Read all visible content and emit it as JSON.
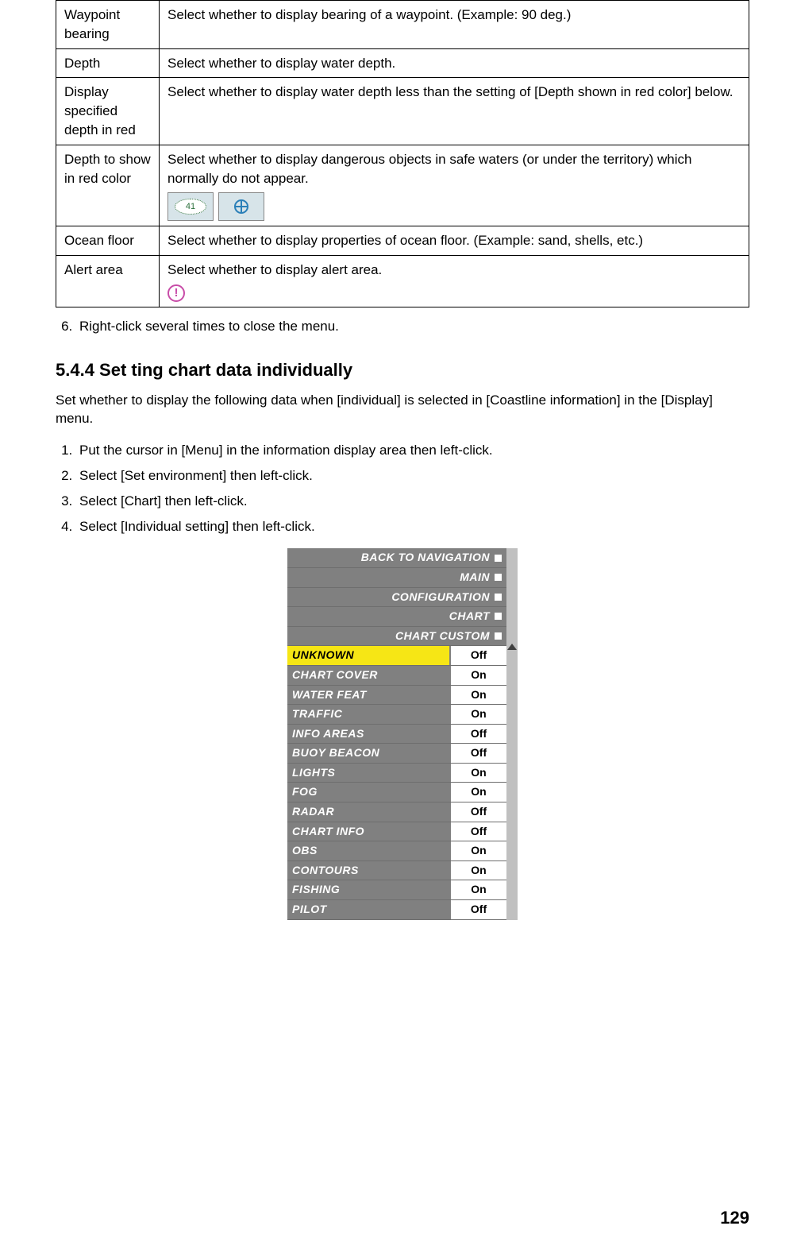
{
  "defs": {
    "r0_term": "Waypoint bearing",
    "r0_desc": "Select whether to display bearing of a waypoint. (Example: 90 deg.)",
    "r1_term": "Depth",
    "r1_desc": "Select whether to display water depth.",
    "r2_term": "Display specified depth in red",
    "r2_desc": "Select whether to display water depth less than the setting of [Depth shown in red color] below.",
    "r3_term": "Depth to show in red color",
    "r3_desc": "Select whether to display dangerous objects in safe waters (or under the territory) which normally do not appear.",
    "r3_chip_number": "41",
    "r4_term": "Ocean floor",
    "r4_desc": "Select whether to display properties of ocean floor. (Example: sand, shells, etc.)",
    "r5_term": "Alert area",
    "r5_desc": "Select whether to display alert area.",
    "r5_alert_glyph": "!"
  },
  "step6": "Right-click several times to close the menu.",
  "section_title": "5.4.4 Set ting chart data individually",
  "section_para": "Set whether to display the following data when [individual] is selected in [Coastline information] in the [Display] menu.",
  "steps": {
    "s1": "Put the cursor in [Menu] in the information display area then left-click.",
    "s2": "Select [Set environment] then left-click.",
    "s3": "Select [Chart] then left-click.",
    "s4": "Select [Individual setting] then left-click."
  },
  "menu": {
    "nav": {
      "n0": "BACK TO NAVIGATION",
      "n1": "MAIN",
      "n2": "CONFIGURATION",
      "n3": "CHART",
      "n4": "CHART CUSTOM"
    },
    "rows": {
      "r0_lbl": "UNKNOWN",
      "r0_val": "Off",
      "r1_lbl": "CHART COVER",
      "r1_val": "On",
      "r2_lbl": "WATER FEAT",
      "r2_val": "On",
      "r3_lbl": "TRAFFIC",
      "r3_val": "On",
      "r4_lbl": "INFO AREAS",
      "r4_val": "Off",
      "r5_lbl": "BUOY BEACON",
      "r5_val": "Off",
      "r6_lbl": "LIGHTS",
      "r6_val": "On",
      "r7_lbl": "FOG",
      "r7_val": "On",
      "r8_lbl": "RADAR",
      "r8_val": "Off",
      "r9_lbl": "CHART INFO",
      "r9_val": "Off",
      "r10_lbl": "OBS",
      "r10_val": "On",
      "r11_lbl": "CONTOURS",
      "r11_val": "On",
      "r12_lbl": "FISHING",
      "r12_val": "On",
      "r13_lbl": "PILOT",
      "r13_val": "Off"
    }
  },
  "page_number": "129"
}
